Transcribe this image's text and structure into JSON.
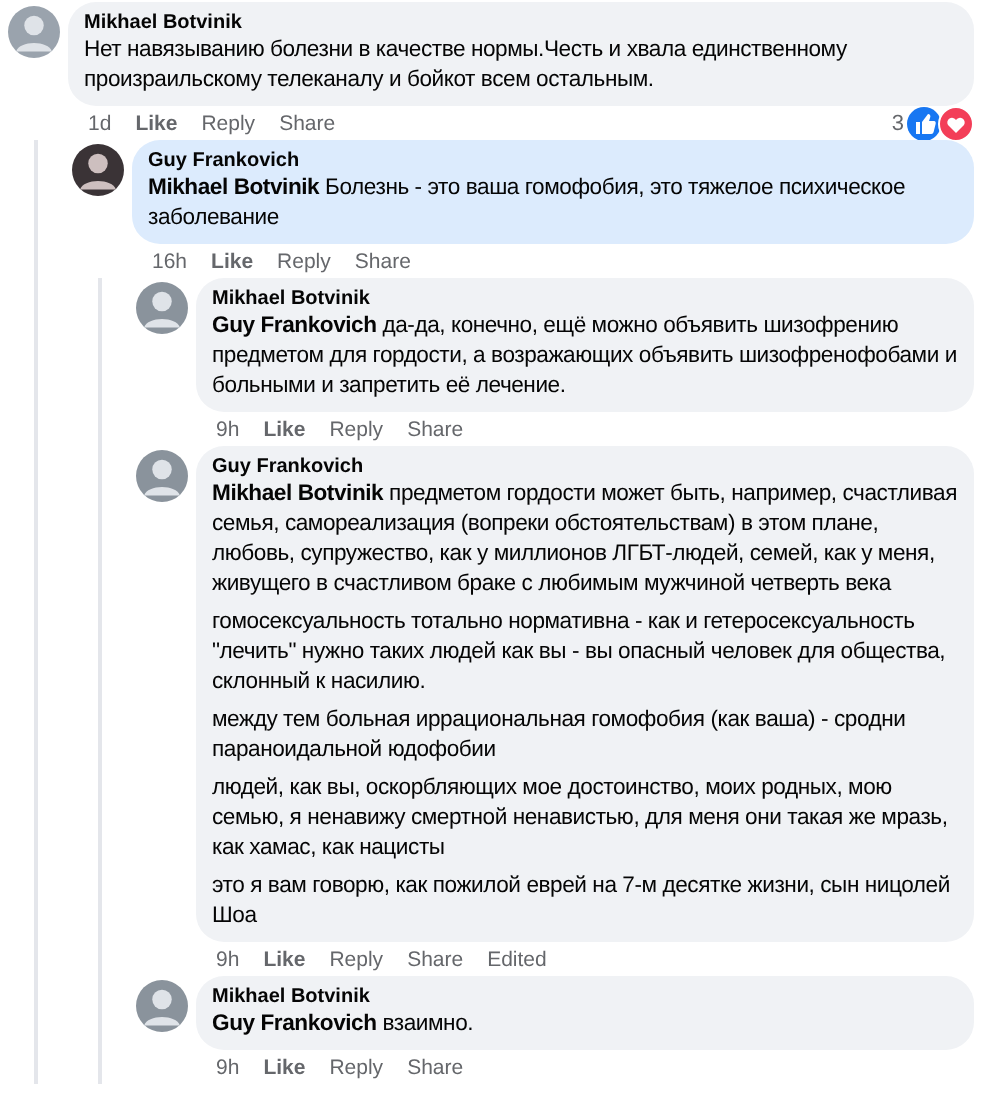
{
  "comments": [
    {
      "author": "Mikhael Botvinik",
      "highlighted": false,
      "paragraphs": [
        "Нет навязыванию болезни в качестве нормы.Честь и хвала единственному произраильскому телеканалу и бойкот всем остальным."
      ],
      "time": "1d",
      "actions": [
        "Like",
        "Reply",
        "Share"
      ],
      "reactions": {
        "count": "3"
      },
      "children": [
        {
          "author": "Guy Frankovich",
          "highlighted": true,
          "paragraphs": [
            "**Mikhael Botvinik** Болезнь - это ваша гомофобия, это тяжелое психическое заболевание"
          ],
          "time": "16h",
          "actions": [
            "Like",
            "Reply",
            "Share"
          ],
          "children": [
            {
              "author": "Mikhael Botvinik",
              "highlighted": false,
              "paragraphs": [
                "**Guy Frankovich** да-да, конечно, ещё можно объявить шизофрению предметом для гордости, а возражающих объявить шизофренофобами и больными и запретить её лечение."
              ],
              "time": "9h",
              "actions": [
                "Like",
                "Reply",
                "Share"
              ]
            },
            {
              "author": "Guy Frankovich",
              "highlighted": false,
              "paragraphs": [
                "**Mikhael Botvinik** предметом гордости может быть, например, счастливая семья, самореализация (вопреки обстоятельствам) в этом плане, любовь, супружество, как у миллионов ЛГБТ-людей, семей, как у меня, живущего в счастливом браке с любимым мужчиной четверть века",
                "гомосексуальность тотально нормативна - как и гетеросексуальность \"лечить\" нужно таких людей как вы - вы опасный человек для общества, склонный к насилию.",
                "между тем больная иррациональная гомофобия (как ваша) - сродни параноидальной юдофобии",
                "людей, как вы, оскорбляющих мое достоинство, моих родных, мою семью, я ненавижу смертной ненавистью, для меня они такая же мразь, как хамас, как нацисты",
                "это я вам говорю, как пожилой еврей на 7-м десятке жизни, сын ницолей Шоа"
              ],
              "time": "9h",
              "actions": [
                "Like",
                "Reply",
                "Share"
              ],
              "edited": "Edited"
            },
            {
              "author": "Mikhael Botvinik",
              "highlighted": false,
              "paragraphs": [
                "**Guy Frankovich** взаимно."
              ],
              "time": "9h",
              "actions": [
                "Like",
                "Reply",
                "Share"
              ]
            }
          ]
        }
      ]
    }
  ]
}
